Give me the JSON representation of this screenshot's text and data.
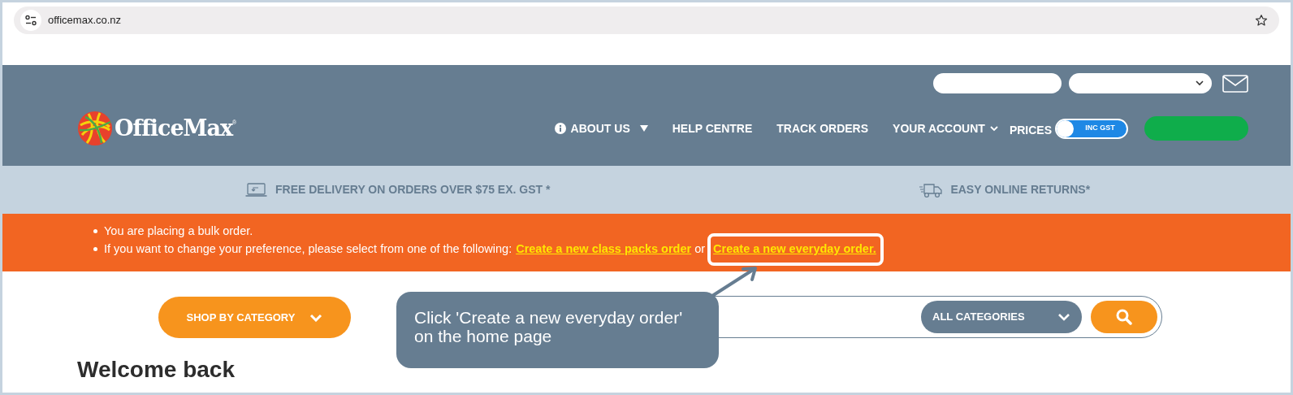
{
  "browser": {
    "url": "officemax.co.nz"
  },
  "logo": {
    "name": "OfficeMax",
    "mark": "®"
  },
  "nav": [
    {
      "label": "ABOUT US",
      "kind": "info-dropdown"
    },
    {
      "label": "HELP CENTRE",
      "kind": "plain"
    },
    {
      "label": "TRACK ORDERS",
      "kind": "plain"
    },
    {
      "label": "YOUR ACCOUNT",
      "kind": "dropdown"
    }
  ],
  "prices": {
    "label": "PRICES",
    "toggle_text": "INC GST",
    "on": true
  },
  "promos": [
    {
      "kind": "laptop",
      "text": "FREE DELIVERY ON ORDERS OVER $75 EX. GST *"
    },
    {
      "kind": "truck",
      "text": "EASY ONLINE RETURNS*"
    }
  ],
  "notice": {
    "line_1": "You are placing a bulk order.",
    "line_2": "If you want to change your preference, please select from one of the following:",
    "link_1": "Create a new class packs order",
    "between": "or",
    "link_2": "Create a new everyday order."
  },
  "shop_button": "SHOP BY CATEGORY",
  "search": {
    "category": "ALL CATEGORIES"
  },
  "heading": "Welcome back",
  "callout": "Click 'Create a new everyday order' on the home page"
}
